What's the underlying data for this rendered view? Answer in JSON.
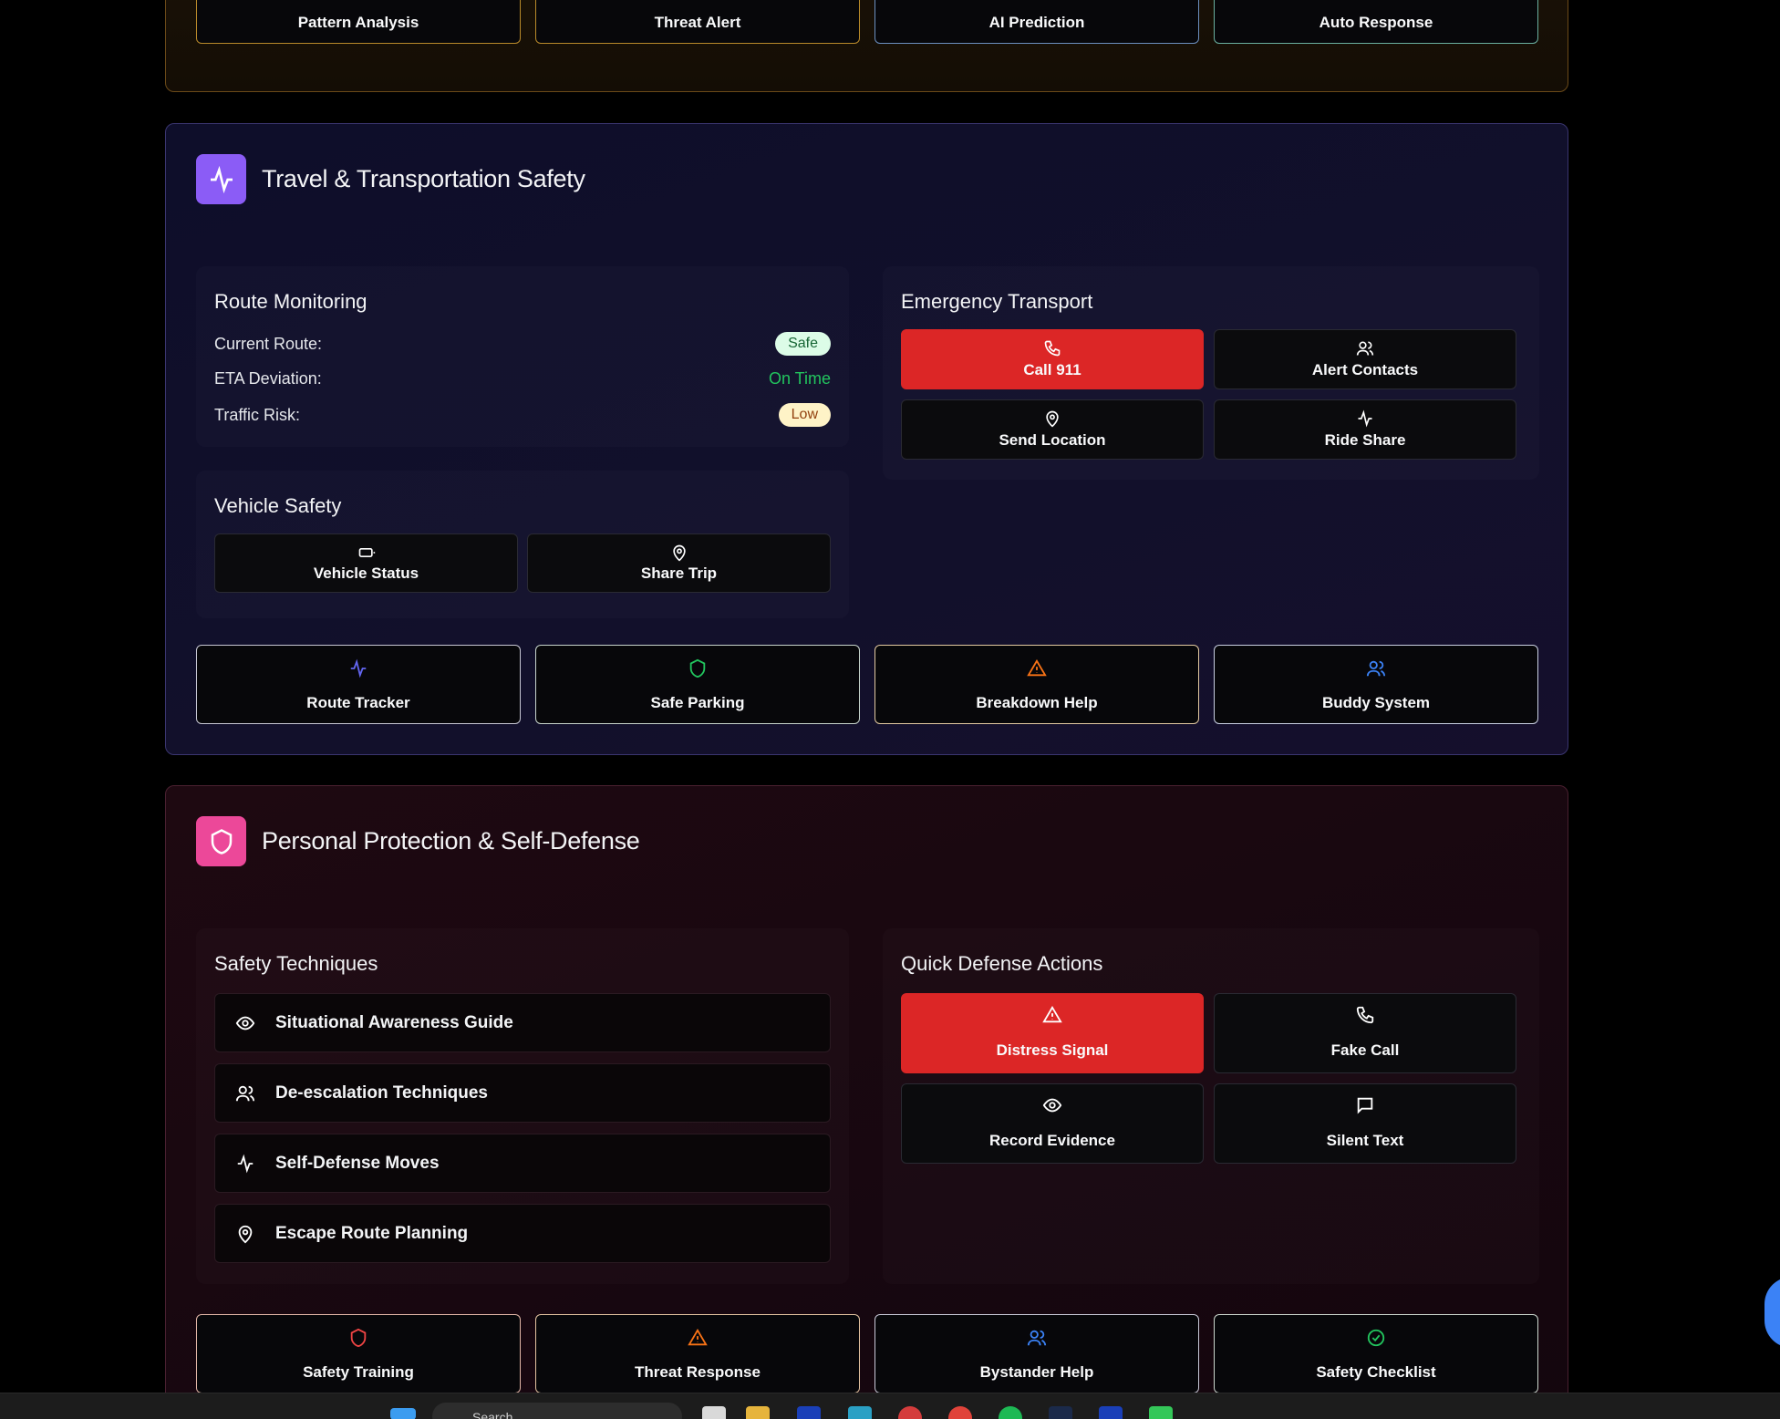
{
  "top_section": {
    "buttons": [
      {
        "label": "Pattern Analysis",
        "icon": "eye-icon",
        "color": "#f59e0b"
      },
      {
        "label": "Threat Alert",
        "icon": "alert-triangle-icon",
        "color": "#ef4444"
      },
      {
        "label": "AI Prediction",
        "icon": "brain-icon",
        "color": "#3b82f6"
      },
      {
        "label": "Auto Response",
        "icon": "shield-icon",
        "color": "#22c55e"
      }
    ]
  },
  "travel": {
    "title": "Travel & Transportation Safety",
    "icon": "activity-icon",
    "route_monitoring": {
      "title": "Route Monitoring",
      "rows": [
        {
          "label": "Current Route:",
          "value": "Safe"
        },
        {
          "label": "ETA Deviation:",
          "value": "On Time"
        },
        {
          "label": "Traffic Risk:",
          "value": "Low"
        }
      ]
    },
    "vehicle_safety": {
      "title": "Vehicle Safety",
      "buttons": [
        {
          "label": "Vehicle Status",
          "icon": "battery-icon"
        },
        {
          "label": "Share Trip",
          "icon": "map-pin-icon"
        }
      ]
    },
    "emergency_transport": {
      "title": "Emergency Transport",
      "buttons": [
        {
          "label": "Call 911",
          "icon": "phone-icon"
        },
        {
          "label": "Alert Contacts",
          "icon": "users-icon"
        },
        {
          "label": "Send Location",
          "icon": "map-pin-icon"
        },
        {
          "label": "Ride Share",
          "icon": "activity-icon"
        }
      ]
    },
    "bottom_buttons": [
      {
        "label": "Route Tracker",
        "icon": "activity-icon",
        "color": "#6366f1"
      },
      {
        "label": "Safe Parking",
        "icon": "shield-icon",
        "color": "#22c55e"
      },
      {
        "label": "Breakdown Help",
        "icon": "alert-triangle-icon",
        "color": "#f97316"
      },
      {
        "label": "Buddy System",
        "icon": "users-icon",
        "color": "#3b82f6"
      }
    ]
  },
  "personal": {
    "title": "Personal Protection & Self-Defense",
    "icon": "shield-icon",
    "techniques": {
      "title": "Safety Techniques",
      "items": [
        {
          "label": "Situational Awareness Guide",
          "icon": "eye-icon"
        },
        {
          "label": "De-escalation Techniques",
          "icon": "users-icon"
        },
        {
          "label": "Self-Defense Moves",
          "icon": "activity-icon"
        },
        {
          "label": "Escape Route Planning",
          "icon": "map-pin-icon"
        }
      ]
    },
    "quick_defense": {
      "title": "Quick Defense Actions",
      "buttons": [
        {
          "label": "Distress Signal",
          "icon": "alert-triangle-icon"
        },
        {
          "label": "Fake Call",
          "icon": "phone-icon"
        },
        {
          "label": "Record Evidence",
          "icon": "eye-icon"
        },
        {
          "label": "Silent Text",
          "icon": "message-icon"
        }
      ]
    },
    "bottom_buttons": [
      {
        "label": "Safety Training",
        "icon": "shield-icon",
        "color": "#ef4444"
      },
      {
        "label": "Threat Response",
        "icon": "alert-triangle-icon",
        "color": "#f97316"
      },
      {
        "label": "Bystander Help",
        "icon": "users-icon",
        "color": "#3b82f6"
      },
      {
        "label": "Safety Checklist",
        "icon": "check-circle-icon",
        "color": "#22c55e"
      }
    ]
  },
  "colors": {
    "travel_accent": "#8b5cf6",
    "personal_accent": "#ec4899",
    "danger": "#dc2626",
    "safe_pill_bg": "#dcfce7",
    "low_pill_bg": "#fef3c7",
    "on_time": "#22c55e"
  },
  "taskbar": {
    "search_placeholder": "Search"
  }
}
